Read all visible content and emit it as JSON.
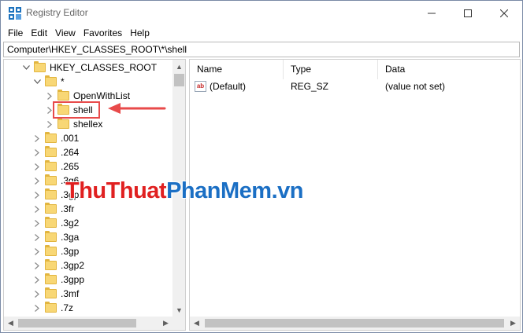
{
  "window": {
    "title": "Registry Editor",
    "minimize_glyph": "—",
    "maximize_glyph": "☐",
    "close_glyph": "✕"
  },
  "menu": [
    "File",
    "Edit",
    "View",
    "Favorites",
    "Help"
  ],
  "address": "Computer\\HKEY_CLASSES_ROOT\\*\\shell",
  "tree": {
    "root": "HKEY_CLASSES_ROOT",
    "star": "*",
    "star_children": [
      "OpenWithList",
      "shell",
      "shellex"
    ],
    "extensions": [
      ".001",
      ".264",
      ".265",
      ".3g6",
      ".3gp2",
      ".3fr",
      ".3g2",
      ".3ga",
      ".3gp",
      ".3gp2",
      ".3gpp",
      ".3mf",
      ".7z"
    ],
    "selected": "shell"
  },
  "list": {
    "columns": [
      "Name",
      "Type",
      "Data"
    ],
    "rows": [
      {
        "name": "(Default)",
        "type": "REG_SZ",
        "data": "(value not set)",
        "icon": "ab-string-icon"
      }
    ]
  },
  "watermark": {
    "part1": "Thu",
    "part2": "Thuat",
    "part3": "Phan",
    "part4": "Mem",
    "part5": ".vn"
  },
  "colors": {
    "annotation_red": "#e84a4a",
    "watermark_red": "#e02020",
    "watermark_blue": "#1b6fc4",
    "folder": "#f8d775"
  }
}
